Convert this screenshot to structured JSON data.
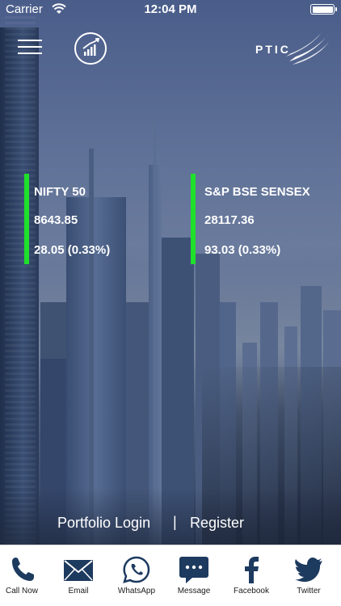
{
  "status_bar": {
    "carrier": "Carrier",
    "time": "12:04 PM"
  },
  "header": {
    "logo_text": "PTIC"
  },
  "indices": [
    {
      "name": "NIFTY 50",
      "value": "8643.85",
      "change": "28.05 (0.33%)"
    },
    {
      "name": "S&P BSE SENSEX",
      "value": "28117.36",
      "change": "93.03 (0.33%)"
    }
  ],
  "auth": {
    "login_label": "Portfolio Login",
    "separator": "|",
    "register_label": "Register"
  },
  "bottom_bar": {
    "tabs": [
      {
        "label": "Call Now",
        "icon": "phone-icon"
      },
      {
        "label": "Email",
        "icon": "envelope-icon"
      },
      {
        "label": "WhatsApp",
        "icon": "whatsapp-icon"
      },
      {
        "label": "Message",
        "icon": "message-bubble-icon"
      },
      {
        "label": "Facebook",
        "icon": "facebook-icon"
      },
      {
        "label": "Twitter",
        "icon": "twitter-icon"
      }
    ]
  },
  "colors": {
    "indicator_green": "#1fe02a",
    "icon_navy": "#1d3a5f",
    "text_white": "#ffffff"
  }
}
